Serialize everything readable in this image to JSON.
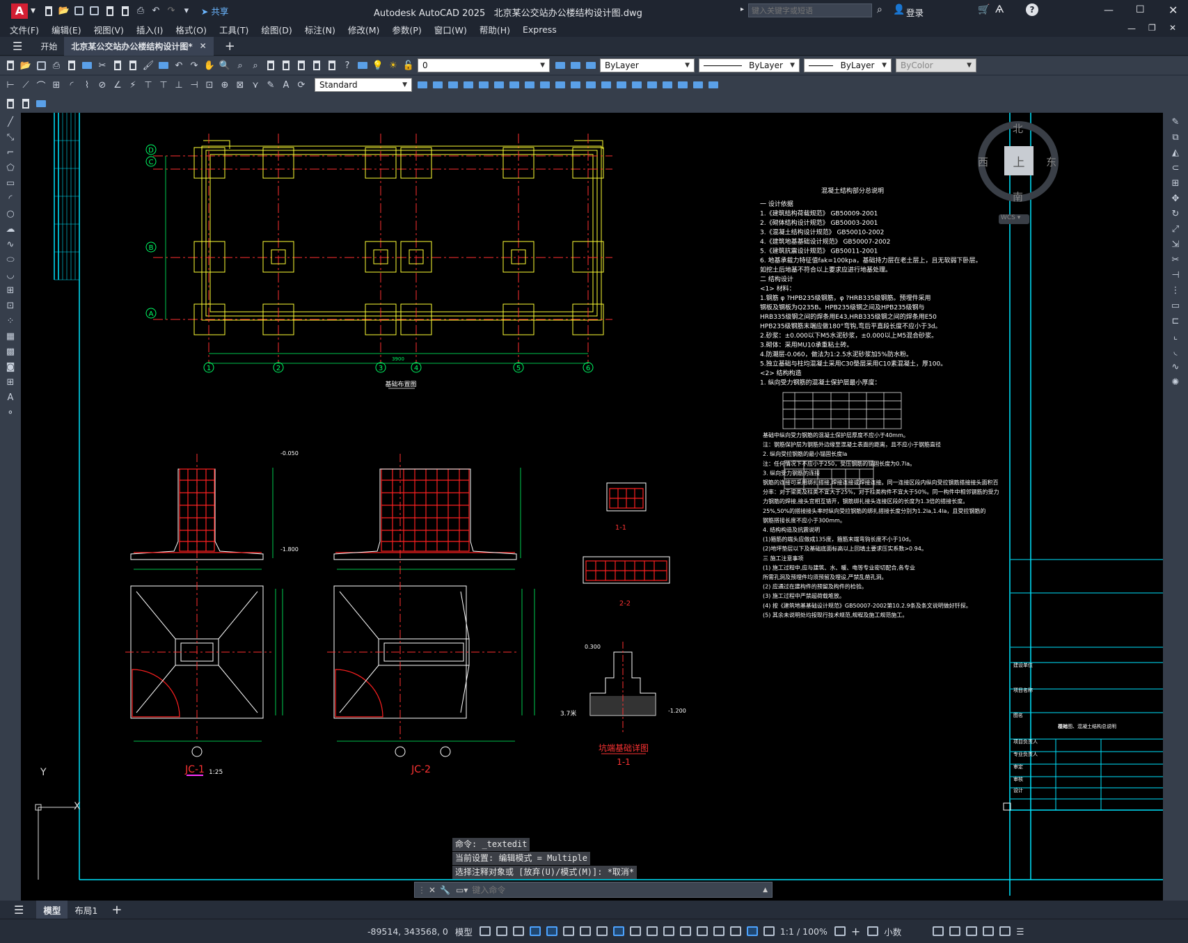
{
  "titlebar": {
    "app_title": "Autodesk AutoCAD 2025",
    "file_title": "北京某公交站办公楼结构设计图.dwg",
    "share_label": "共享",
    "search_placeholder": "键入关键字或短语",
    "login_label": "登录"
  },
  "menus": [
    "文件(F)",
    "编辑(E)",
    "视图(V)",
    "插入(I)",
    "格式(O)",
    "工具(T)",
    "绘图(D)",
    "标注(N)",
    "修改(M)",
    "参数(P)",
    "窗口(W)",
    "帮助(H)",
    "Express"
  ],
  "tabs": {
    "start": "开始",
    "active": "北京某公交站办公楼结构设计图*",
    "add": "+"
  },
  "toolbar": {
    "layer_value": "0",
    "color_value": "ByLayer",
    "linetype_value": "ByLayer",
    "lineweight_value": "ByLayer",
    "plotstyle_value": "ByColor",
    "textstyle_value": "Standard"
  },
  "viewcube": {
    "north": "北",
    "south": "南",
    "east": "东",
    "west": "西",
    "top": "上",
    "wcs": "WCS"
  },
  "drawing": {
    "grid_letters": [
      "D",
      "C",
      "B",
      "A"
    ],
    "grid_numbers": [
      "1",
      "2",
      "3",
      "4",
      "5",
      "6"
    ],
    "plan_title": "基础布置图",
    "notes_title": "混凝土结构部分总说明",
    "notes": [
      "一 设计依据",
      "1.《建筑结构荷载规范》          GB50009-2001",
      "2.《砌体结构设计规范》          GB50003-2001",
      "3.《混凝土结构设计规范》        GB50010-2002",
      "4.《建筑地基基础设计规范》      GB50007-2002",
      "5.《建筑抗震设计规范》          GB50011-2001",
      "6. 地基承载力特征值fak=100kpa，基础持力层在老土层上，且无软弱下卧层。",
      "   如挖土后地基不符合以上要求应进行地基处理。",
      "二 结构设计",
      " <1> 材料：",
      "1.钢筋 φ ?HPB235级钢筋，φ ?HRB335级钢筋。预埋件采用",
      "  钢板及钢板为Q235B。HPB235级钢之间及HPB235级钢与",
      "  HRB335级钢之间的焊条用E43,HRB335级钢之间的焊条用E50",
      "  HPB235级钢筋末端应做180°弯钩,弯后平直段长度不应小于3d。",
      "2.砂浆：±0.000以下M5水泥砂浆，±0.000以上M5混合砂浆。",
      "3.砌体：采用MU10承重粘土砖。",
      "4.防潮层-0.060，做法为1:2.5水泥砂浆加5%防水粉。",
      "5.独立基础与柱均混凝土采用C30垫层采用C10素混凝土，厚100。",
      " <2> 结构构造",
      "1. 纵向受力钢筋的混凝土保护层最小厚度："
    ],
    "notes2": [
      "基础中纵向受力钢筋的混凝土保护层厚度不应小于40mm。",
      "注：钢筋保护层为钢筋外边缘至混凝土表面的距离，且不应小于钢筋直径",
      "2. 纵向受拉钢筋的最小锚固长度la",
      "注：任何情况下不应小于250，受压钢筋的锚固长度为0.7la。",
      "3. 纵向受力钢筋的连接",
      "钢筋的连接可采用绑扎搭接,焊接连接或焊接连接。同一连接区段内纵向受拉钢筋搭接接头面积百",
      "分率：对于梁类及柱类不宜大于25%，对于柱类构件不宜大于50%。同一构件中相邻钢筋的受力",
      "力钢筋的焊接,接头宜相互错开，钢筋绑扎接头连接区段的长度为1.3倍的搭接长度。",
      "25%,50%的搭接接头率时纵向受拉钢筋的绑扎搭接长度分别为1.2la,1.4la，且受拉钢筋的",
      "钢筋搭接长度不应小于300mm。",
      "4. 结构构造及抗震说明",
      "(1)箍筋的端头应做成135度，箍筋末端弯钩长度不小于10d。",
      "(2)地坪垫层以下及基础底面标高以上回填土要求压实系数>0.94。",
      "三 施工注意事项",
      "(1) 施工过程中,应与建筑、水、暖、电等专业密切配合,各专业",
      "    所需孔洞及预埋件均须预留及埋设,严禁乱凿孔洞。",
      "(2) 应通过在建构件的预留及构件的检验。",
      "(3) 施工过程中严禁超荷载堆放。",
      "(4) 按《建筑地基基础设计规范》GB50007-2002第10.2.9条及条文说明做好钎探。",
      "(5) 其余未说明处均按现行技术规范,规程及施工规范施工。"
    ],
    "detail_labels": [
      "JC-1",
      "JC-2",
      "1:25",
      "1-1",
      "2-2",
      "坑端基础详图",
      "1-1"
    ],
    "elev_labels": [
      "-0.050",
      "-1.800",
      "0.300",
      "-1.200",
      "3.7米"
    ],
    "titleblock": [
      "建设单位",
      "项目名称",
      "图名",
      "项目负责人",
      "专业负责人",
      "审定",
      "审核",
      "设计",
      "校对",
      "基础图、混凝土结构总说明"
    ],
    "dim_total": "3900"
  },
  "command": {
    "lines": [
      "命令: _textedit",
      "当前设置: 编辑模式 = Multiple",
      "选择注释对象或 [放弃(U)/模式(M)]: *取消*"
    ],
    "input_placeholder": "键入命令"
  },
  "layout_tabs": [
    "模型",
    "布局1",
    "+"
  ],
  "status": {
    "coords": "-89514, 343568, 0",
    "model_label": "模型",
    "scale": "1:1 / 100%",
    "units": "小数"
  },
  "ucs": {
    "y": "Y",
    "x": "X"
  }
}
